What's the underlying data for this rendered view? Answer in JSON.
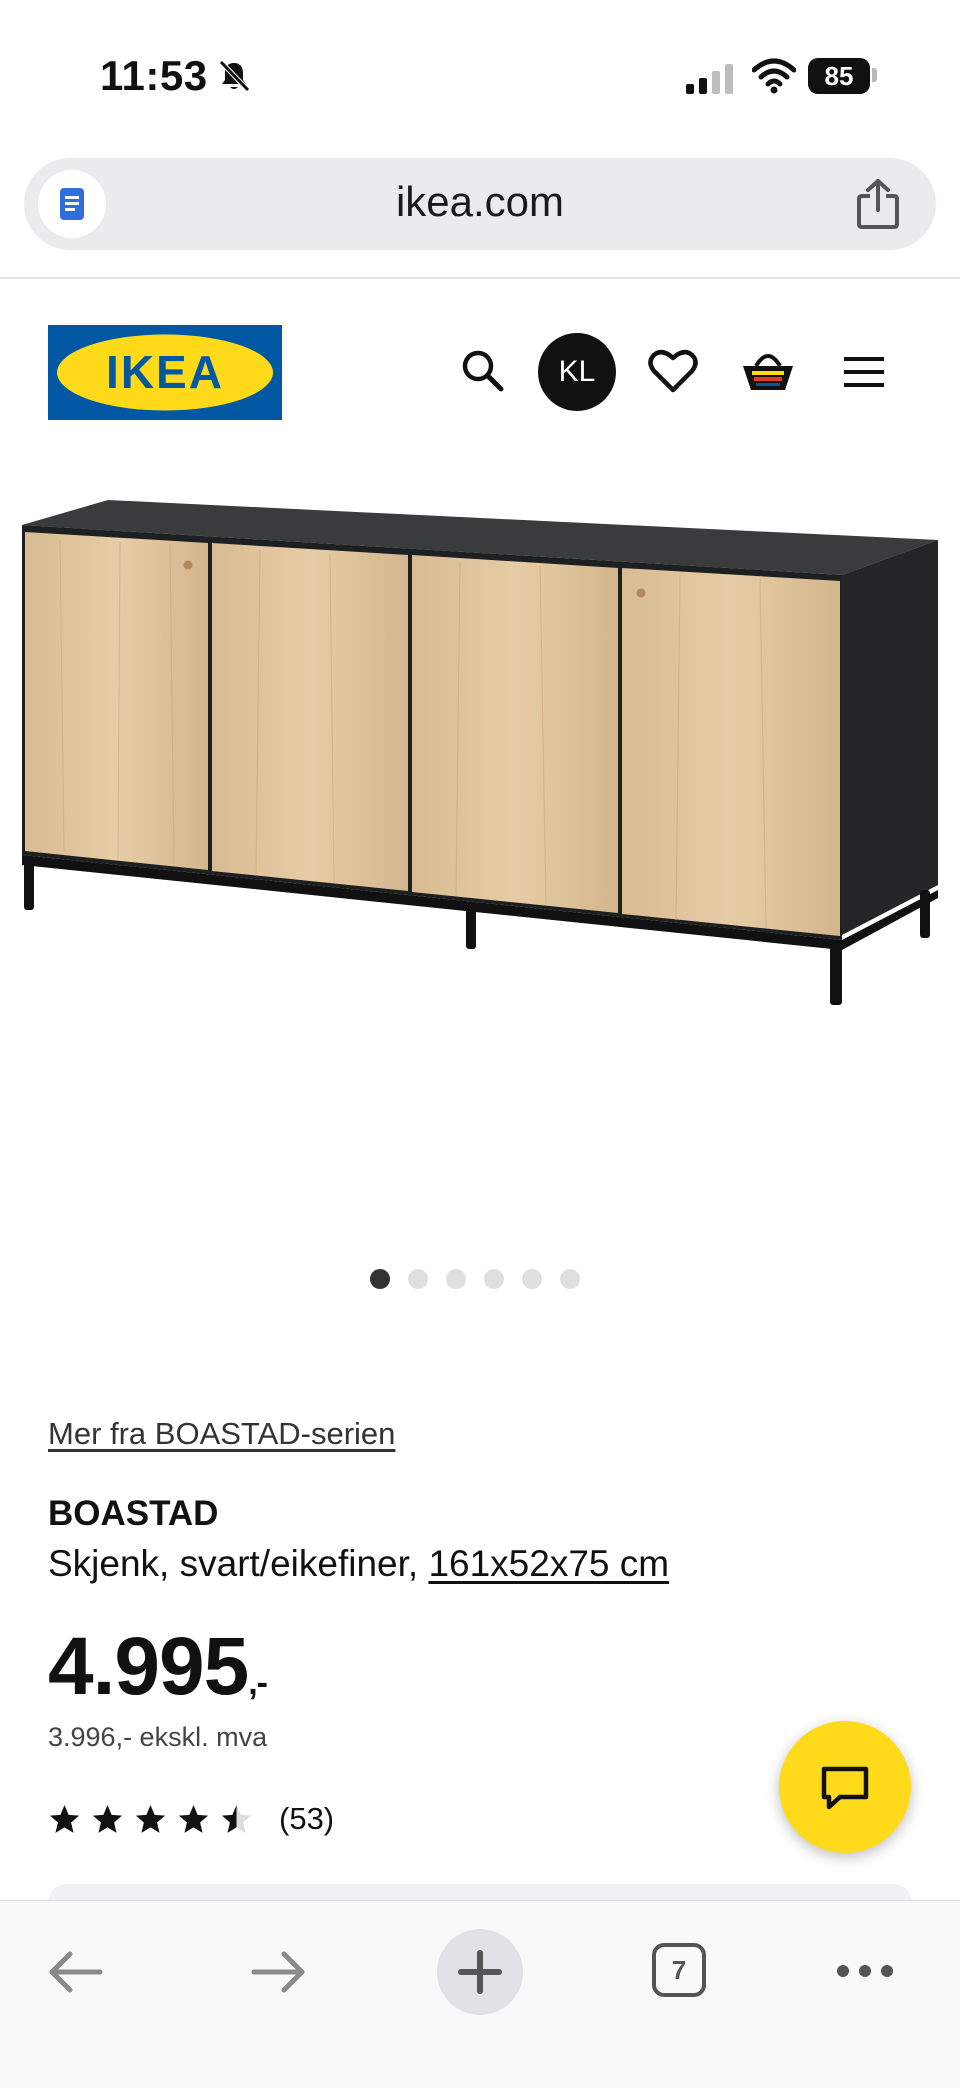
{
  "status_bar": {
    "time": "11:53",
    "battery": "85"
  },
  "browser": {
    "url": "ikea.com",
    "tab_count": "7"
  },
  "header": {
    "logo_text": "IKEA",
    "profile_initials": "KL"
  },
  "carousel": {
    "total": 6,
    "active": 1
  },
  "product": {
    "series_link": "Mer fra BOASTAD-serien",
    "name": "BOASTAD",
    "description": "Skjenk, svart/eikefiner, ",
    "dimensions": "161x52x75 cm",
    "price": "4.995",
    "price_suffix": ",-",
    "price_excl_vat": "3.996,- ekskl. mva",
    "rating": 4.5,
    "rating_max": 5,
    "review_count": "(53)"
  },
  "colors": {
    "ikea_blue": "#0058a3",
    "ikea_yellow": "#ffda1a",
    "text": "#111111"
  },
  "icons": [
    "bell-slash-icon",
    "signal-icon",
    "wifi-icon",
    "reader-icon",
    "share-icon",
    "search-icon",
    "heart-icon",
    "cart-icon",
    "menu-icon",
    "chat-icon",
    "back-icon",
    "forward-icon",
    "plus-icon",
    "more-icon"
  ]
}
